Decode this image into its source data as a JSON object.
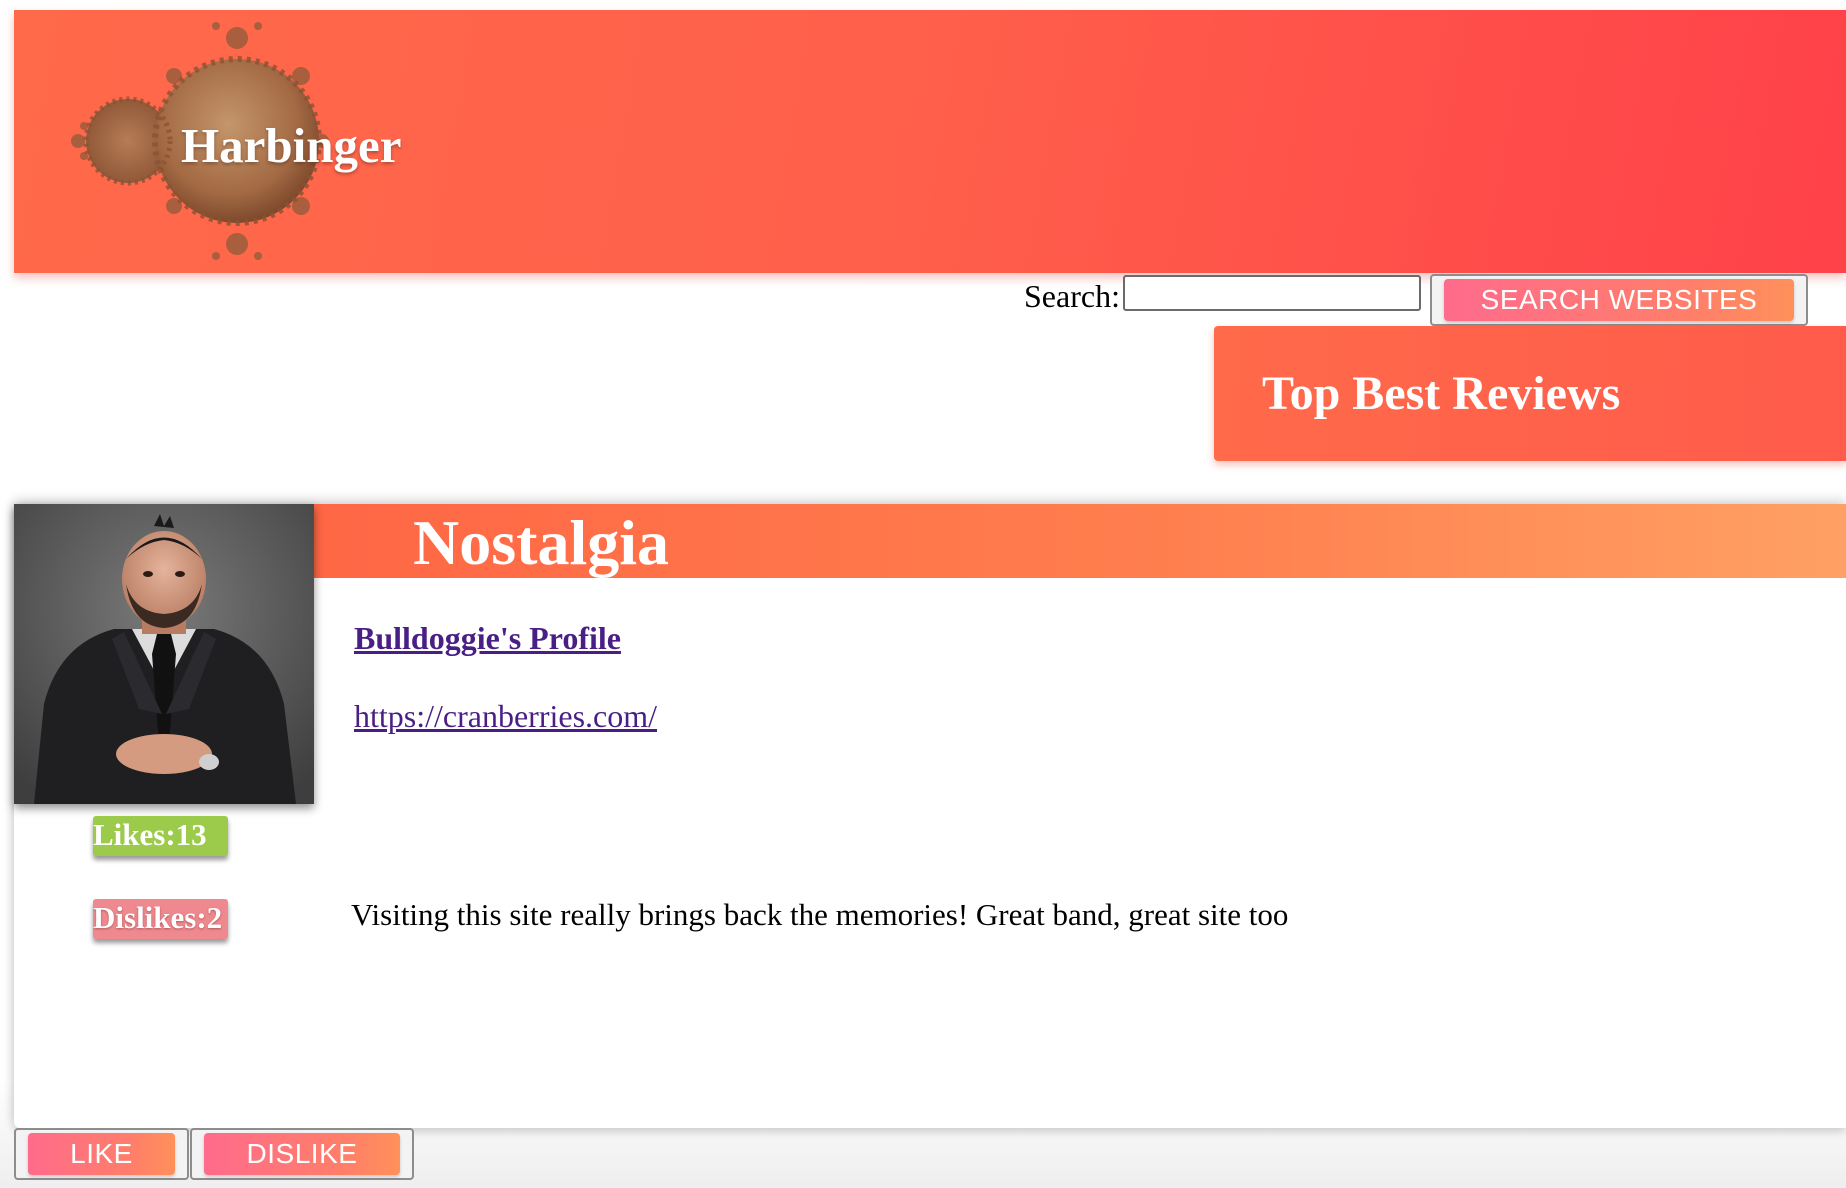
{
  "header": {
    "site_title": "Harbinger",
    "logo_icon": "mandelbrot-fractal-icon"
  },
  "search": {
    "label": "Search:",
    "value": "",
    "placeholder": "",
    "button_label": "SEARCH WEBSITES"
  },
  "top_reviews": {
    "title": "Top Best Reviews"
  },
  "review": {
    "title": "Nostalgia",
    "avatar_icon": "user-photo-avatar",
    "profile_link": "Bulldoggie's Profile",
    "site_link": "https://cranberries.com/",
    "likes_label": "Likes:13",
    "dislikes_label": "Dislikes:2",
    "likes": 13,
    "dislikes": 2,
    "text": "Visiting this site really brings back the memories! Great band, great site too"
  },
  "actions": {
    "like_label": "LIKE",
    "dislike_label": "DISLIKE"
  },
  "colors": {
    "header": "#ff5a4a",
    "button_pink": "#ff6b8c",
    "button_orange": "#ff905a",
    "likes_green": "#9ccb4b",
    "dislikes_pink": "#ee8a8f",
    "link_purple": "#4a1f85"
  }
}
